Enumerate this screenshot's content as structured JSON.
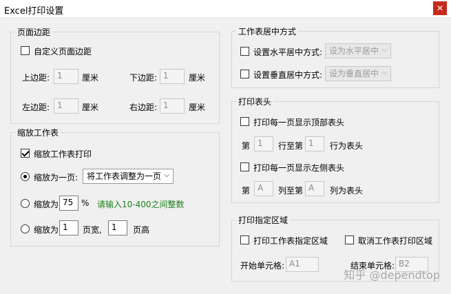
{
  "window": {
    "title": "Excel打印设置",
    "close_glyph": "✕"
  },
  "margins": {
    "title": "页面边距",
    "custom_checkbox_label": "自定义页面边距",
    "top_label": "上边距:",
    "top_value": "1",
    "bottom_label": "下边距:",
    "bottom_value": "1",
    "left_label": "左边距:",
    "left_value": "1",
    "right_label": "右边距:",
    "right_value": "1",
    "unit": "厘米"
  },
  "centering": {
    "title": "工作表居中方式",
    "horizontal_label": "设置水平居中方式:",
    "horizontal_select": "设为水平居中",
    "vertical_label": "设置垂直居中方式:",
    "vertical_select": "设为垂直居中"
  },
  "scaling": {
    "title": "缩放工作表",
    "enable_label": "缩放工作表打印",
    "fit_one_label": "缩放为一页:",
    "fit_one_select": "将工作表调整为一页",
    "percent_label": "缩放为",
    "percent_value": "75",
    "percent_unit": "%",
    "percent_hint": "请输入10-400之间整数",
    "pages_label": "缩放为",
    "pages_wide_value": "1",
    "pages_wide_unit": "页宽,",
    "pages_tall_value": "1",
    "pages_tall_unit": "页高"
  },
  "headers": {
    "title": "打印表头",
    "top_rows_label": "打印每一页显示顶部表头",
    "row_from_label": "第",
    "row_from_value": "1",
    "row_to_label": "行至第",
    "row_to_value": "1",
    "row_suffix": "行为表头",
    "left_cols_label": "打印每一页显示左侧表头",
    "col_from_label": "第",
    "col_from_value": "A",
    "col_to_label": "列至第",
    "col_to_value": "A",
    "col_suffix": "列为表头"
  },
  "area": {
    "title": "打印指定区域",
    "print_area_label": "打印工作表指定区域",
    "cancel_area_label": "取消工作表打印区域",
    "start_label": "开始单元格:",
    "start_value": "A1",
    "end_label": "结束单元格:",
    "end_value": "B2"
  },
  "watermark": "知乎 @dependtop",
  "colors": {
    "close": "#c42b1c",
    "hint": "#1a7f1a"
  }
}
